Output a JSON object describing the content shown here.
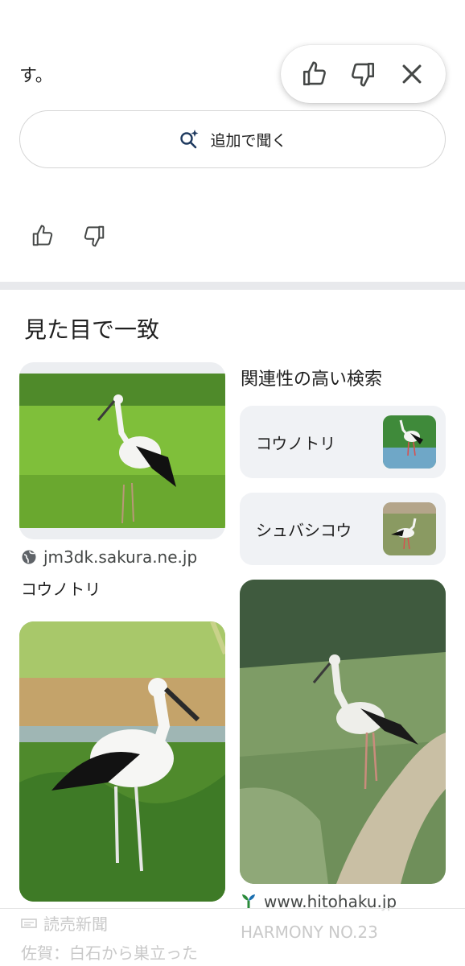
{
  "answer": {
    "trailing_text": "す。"
  },
  "feedback": {
    "thumbs_up": "thumbs-up-icon",
    "thumbs_down": "thumbs-down-icon",
    "close": "close-icon"
  },
  "ask_more": {
    "label": "追加で聞く",
    "icon": "sparkle-search-icon"
  },
  "visual_matches": {
    "title": "見た目で一致",
    "results": [
      {
        "source": "jm3dk.sakura.ne.jp",
        "caption": "コウノトリ"
      },
      {
        "source": "www.hitohaku.jp",
        "caption": "HARMONY NO.23"
      },
      {
        "source": "読売新聞",
        "caption": "佐賀：白石から巣立った"
      }
    ]
  },
  "related_searches": {
    "title": "関連性の高い検索",
    "items": [
      {
        "label": "コウノトリ"
      },
      {
        "label": "シュバシコウ"
      }
    ]
  },
  "colors": {
    "divider": "#e8e9ec",
    "chip_bg": "#f0f2f5",
    "text": "#1f1f1f",
    "muted": "#444746"
  }
}
